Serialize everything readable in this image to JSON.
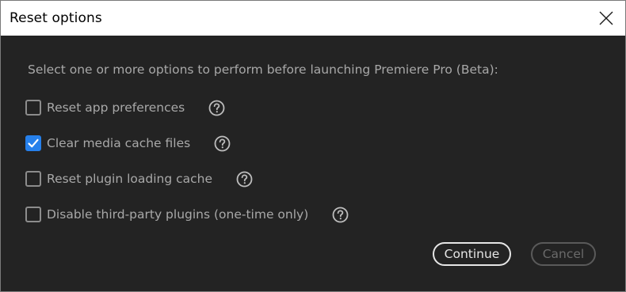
{
  "window": {
    "title": "Reset options"
  },
  "dialog": {
    "prompt": "Select one or more options to perform before launching Premiere Pro (Beta):",
    "options": [
      {
        "label": "Reset app preferences",
        "checked": false
      },
      {
        "label": "Clear media cache files",
        "checked": true
      },
      {
        "label": "Reset plugin loading cache",
        "checked": false
      },
      {
        "label": "Disable third-party plugins (one-time only)",
        "checked": false
      }
    ],
    "buttons": {
      "continue_label": "Continue",
      "cancel_label": "Cancel",
      "cancel_enabled": false
    }
  },
  "icons": {
    "close": "close-icon",
    "help": "help-circle-icon",
    "check": "checkmark-icon"
  },
  "colors": {
    "background": "#232323",
    "accent": "#2680eb",
    "text": "#a8a8a8"
  }
}
